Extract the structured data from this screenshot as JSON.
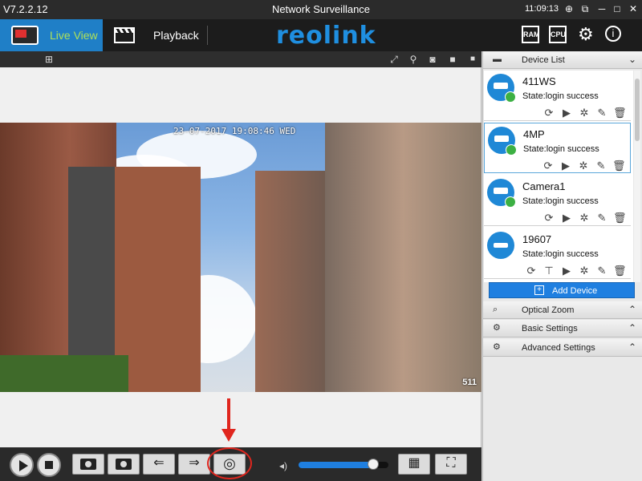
{
  "titlebar": {
    "version": "V7.2.2.12",
    "title": "Network Surveillance",
    "clock": "11:09:13"
  },
  "nav": {
    "live_view": "Live View",
    "playback": "Playback",
    "logo": "reolink",
    "ram_label": "RAM",
    "cpu_label": "CPU"
  },
  "video": {
    "osd_timestamp": "23-07-2017 19:08:46 WED",
    "osd_channel": "511"
  },
  "controls": {
    "volume_level": 0.83
  },
  "device_list": {
    "header": "Device List",
    "devices": [
      {
        "name": "411WS",
        "state": "State:login success",
        "selected": false
      },
      {
        "name": "4MP",
        "state": "State:login success",
        "selected": true
      },
      {
        "name": "Camera1",
        "state": "State:login success",
        "selected": false
      },
      {
        "name": "19607",
        "state": "State:login success",
        "selected": false
      }
    ],
    "add_device": "Add Device"
  },
  "sections": {
    "optical_zoom": "Optical Zoom",
    "basic_settings": "Basic Settings",
    "advanced_settings": "Advanced Settings"
  },
  "colors": {
    "accent": "#1f7fc7",
    "live_label": "#aee05a",
    "annotation": "#e0261e"
  }
}
